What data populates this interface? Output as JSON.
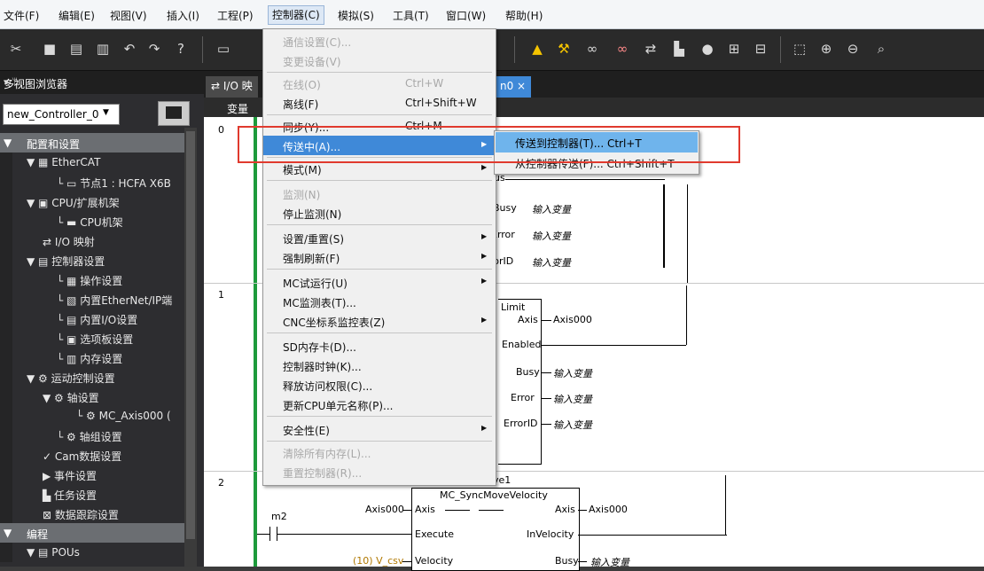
{
  "menubar": {
    "items": [
      "文件(F)",
      "编辑(E)",
      "视图(V)",
      "插入(I)",
      "工程(P)",
      "控制器(C)",
      "模拟(S)",
      "工具(T)",
      "窗口(W)",
      "帮助(H)"
    ]
  },
  "left_panel": {
    "title": "多视图浏览器",
    "pin": "▾ ᛘ",
    "controller": "new_Controller_0",
    "tree": [
      "配置和设置",
      "EtherCAT",
      "节点1 : HCFA X6B",
      "CPU/扩展机架",
      "CPU机架",
      "I/O 映射",
      "控制器设置",
      "操作设置",
      "内置EtherNet/IP端",
      "内置I/O设置",
      "选项板设置",
      "内存设置",
      "运动控制设置",
      "轴设置",
      "MC_Axis000 (",
      "轴组设置",
      "Cam数据设置",
      "事件设置",
      "任务设置",
      "数据跟踪设置",
      "编程",
      "POUs"
    ]
  },
  "tabs": {
    "io_map": "I/O 映",
    "program": "n0 ×"
  },
  "editor": {
    "vars_label": "变量",
    "rungs": [
      "0",
      "1",
      "2"
    ],
    "rung0_pins": [
      "atus",
      "Busy",
      "Error",
      "rorID"
    ],
    "placeholder": "输入变量",
    "rung1_name": "Limit",
    "rung1_pins": {
      "axis": "Axis",
      "axis_var": "Axis000",
      "enabled": "Enabled",
      "busy": "Busy",
      "error": "Error",
      "errorid": "ErrorID"
    },
    "rung2": {
      "instance": "ve1",
      "fb_name": "MC_SyncMoveVelocity",
      "axis_in_var": "Axis000",
      "axis_in": "Axis",
      "axis_out": "Axis",
      "axis_out_var": "Axis000",
      "contact": "m2",
      "execute": "Execute",
      "invelocity": "InVelocity",
      "vel_var": "(10) V_csv",
      "velocity": "Velocity",
      "busy": "Busy"
    }
  },
  "controller_menu": {
    "items": [
      {
        "label": "通信设置(C)...",
        "shortcut": "",
        "disabled": true
      },
      {
        "label": "变更设备(V)",
        "shortcut": "",
        "disabled": true
      },
      {
        "label": "在线(O)",
        "shortcut": "Ctrl+W",
        "disabled": true
      },
      {
        "label": "离线(F)",
        "shortcut": "Ctrl+Shift+W",
        "disabled": false
      },
      {
        "label": "同步(Y)...",
        "shortcut": "Ctrl+M",
        "disabled": false
      },
      {
        "label": "传送中(A)...",
        "shortcut": "",
        "disabled": false,
        "submenu": true
      },
      {
        "label": "模式(M)",
        "shortcut": "",
        "disabled": false,
        "submenu": true
      },
      {
        "label": "监测(N)",
        "shortcut": "",
        "disabled": true
      },
      {
        "label": "停止监测(N)",
        "shortcut": "",
        "disabled": false
      },
      {
        "label": "设置/重置(S)",
        "shortcut": "",
        "disabled": false,
        "submenu": true
      },
      {
        "label": "强制刷新(F)",
        "shortcut": "",
        "disabled": false,
        "submenu": true
      },
      {
        "label": "MC试运行(U)",
        "shortcut": "",
        "disabled": false,
        "submenu": true
      },
      {
        "label": "MC监测表(T)...",
        "shortcut": "",
        "disabled": false
      },
      {
        "label": "CNC坐标系监控表(Z)",
        "shortcut": "",
        "disabled": false,
        "submenu": true
      },
      {
        "label": "SD内存卡(D)...",
        "shortcut": "",
        "disabled": false
      },
      {
        "label": "控制器时钟(K)...",
        "shortcut": "",
        "disabled": false
      },
      {
        "label": "释放访问权限(C)...",
        "shortcut": "",
        "disabled": false
      },
      {
        "label": "更新CPU单元名称(P)...",
        "shortcut": "",
        "disabled": false
      },
      {
        "label": "安全性(E)",
        "shortcut": "",
        "disabled": false,
        "submenu": true
      },
      {
        "label": "清除所有内存(L)...",
        "shortcut": "",
        "disabled": true
      },
      {
        "label": "重置控制器(R)...",
        "shortcut": "",
        "disabled": true
      }
    ],
    "submenu_arrow": "▶"
  },
  "transfer_submenu": {
    "to_controller": "传送到控制器(T)... Ctrl+T",
    "from_controller": "从控制器传送(F)... Ctrl+Shift+T"
  },
  "colors": {
    "highlight": "#3f89d8",
    "submenu_highlight": "#6fb4ec",
    "callout": "#e03a2e",
    "rail": "#1d9a3b"
  }
}
